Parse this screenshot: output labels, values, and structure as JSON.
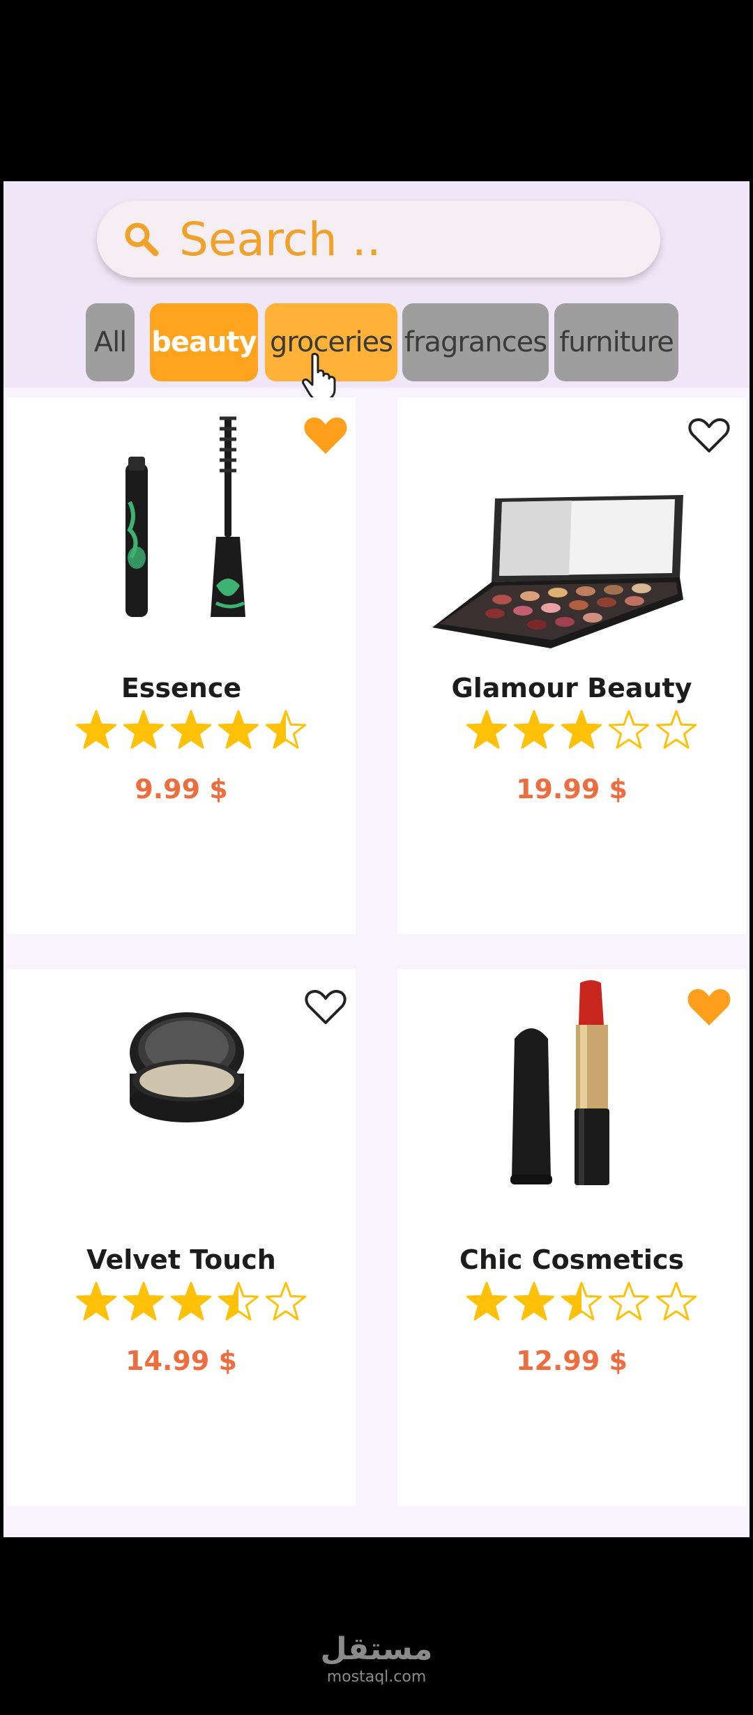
{
  "search": {
    "placeholder": "Search .."
  },
  "categories": [
    {
      "label": "All",
      "state": "default"
    },
    {
      "label": "beauty",
      "state": "selected"
    },
    {
      "label": "groceries",
      "state": "hover"
    },
    {
      "label": "fragrances",
      "state": "default"
    },
    {
      "label": "furniture",
      "state": "default"
    }
  ],
  "products": [
    {
      "name": "Essence",
      "price": "9.99 $",
      "rating": 4.5,
      "favorite": true,
      "image": "mascara"
    },
    {
      "name": "Glamour Beauty",
      "price": "19.99 $",
      "rating": 3,
      "favorite": false,
      "image": "eyeshadow-palette"
    },
    {
      "name": "Velvet Touch",
      "price": "14.99 $",
      "rating": 3.5,
      "favorite": false,
      "image": "powder-compact"
    },
    {
      "name": "Chic Cosmetics",
      "price": "12.99 $",
      "rating": 2.5,
      "favorite": true,
      "image": "lipstick"
    }
  ],
  "colors": {
    "accent": "#ffa21d",
    "price": "#ee6d3e",
    "star": "#ffc107",
    "chip_default": "#9e9e9e",
    "favorite": "#ff9f1c"
  },
  "watermark": {
    "logo": "مستقل",
    "url": "mostaql.com"
  }
}
